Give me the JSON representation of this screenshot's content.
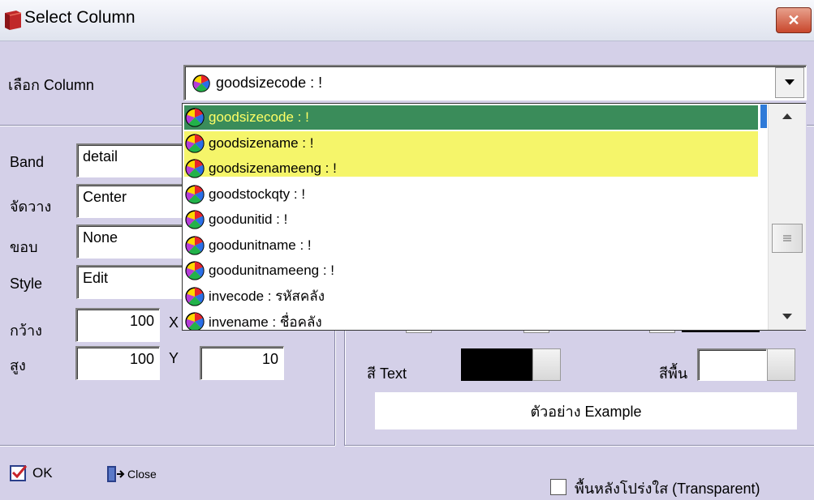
{
  "window": {
    "title": "Select Column",
    "close_label": "✕"
  },
  "select_column": {
    "label": "เลือก Column",
    "value": "goodsizecode : !"
  },
  "dropdown_items": [
    "goodsizecode : !",
    "goodsizename : !",
    "goodsizenameeng : !",
    "goodstockqty : !",
    "goodunitid : !",
    "goodunitname : !",
    "goodunitnameeng : !",
    "invecode : รหัสคลัง",
    "invename : ชื่อคลัง"
  ],
  "fields": {
    "band": {
      "label": "Band",
      "value": "detail"
    },
    "align": {
      "label": "จัดวาง",
      "value": "Center"
    },
    "border": {
      "label": "ขอบ",
      "value": "None"
    },
    "style": {
      "label": "Style",
      "value": "Edit"
    },
    "width": {
      "label": "กว้าง",
      "value": "100",
      "coord_label": "X"
    },
    "height": {
      "label": "สูง",
      "value": "100",
      "coord_label": "Y",
      "coord_value": "10"
    }
  },
  "colors_panel": {
    "text_color_label": "สี Text",
    "bg_color_label": "สีพื้น",
    "text_color": "#000000",
    "bg_color": "#ffffff",
    "preview_text": "ตัวอย่าง Example"
  },
  "footer": {
    "ok_label": "OK",
    "close_label": "Close",
    "transparent_label": "พื้นหลังโปร่งใส (Transparent)"
  },
  "highlight_colors": {
    "selected": "#3a8c5a",
    "hover": "#f5f56a"
  }
}
